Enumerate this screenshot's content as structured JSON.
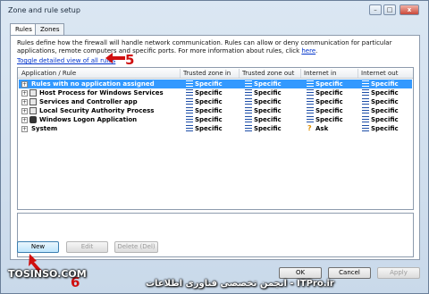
{
  "window": {
    "title": "Zone and rule setup",
    "minimize_glyph": "–",
    "maximize_glyph": "□",
    "close_glyph": "x"
  },
  "tabs": [
    {
      "label": "Rules",
      "active": true
    },
    {
      "label": "Zones",
      "active": false
    }
  ],
  "description": {
    "text": "Rules define how the firewall will handle network communication. Rules can allow or deny communication for particular applications, remote computers and specific ports. For more information about rules, click ",
    "link": "here",
    "end": "."
  },
  "toggle_link": "Toggle detailed view of all rules",
  "annotations": {
    "step5": "5",
    "step5_color": "#d01010",
    "step_new": "6"
  },
  "list": {
    "columns": [
      "Application / Rule",
      "Trusted zone in",
      "Trusted zone out",
      "Internet in",
      "Internet out"
    ],
    "rows": [
      {
        "name": "Rules with no application assigned",
        "icon": "none",
        "selected": true,
        "values": [
          "Specific",
          "Specific",
          "Specific",
          "Specific"
        ]
      },
      {
        "name": "Host Process for Windows Services",
        "icon": "app-icon",
        "selected": false,
        "values": [
          "Specific",
          "Specific",
          "Specific",
          "Specific"
        ]
      },
      {
        "name": "Services and Controller app",
        "icon": "app-icon",
        "selected": false,
        "values": [
          "Specific",
          "Specific",
          "Specific",
          "Specific"
        ]
      },
      {
        "name": "Local Security Authority Process",
        "icon": "app-icon",
        "selected": false,
        "values": [
          "Specific",
          "Specific",
          "Specific",
          "Specific"
        ]
      },
      {
        "name": "Windows Logon Application",
        "icon": "lock-icon",
        "selected": false,
        "values": [
          "Specific",
          "Specific",
          "Specific",
          "Specific"
        ]
      },
      {
        "name": "System",
        "icon": "none",
        "selected": false,
        "values": [
          "Specific",
          "Specific",
          "Ask",
          "Specific"
        ]
      }
    ]
  },
  "buttons": {
    "new": "New",
    "edit": "Edit",
    "delete": "Delete (Del)",
    "ok": "OK",
    "cancel": "Cancel",
    "apply": "Apply"
  },
  "watermark": {
    "left": "TOSINSO.COM",
    "right": "انجمن تخصصی فناوری اطلاعات - ITPro.ir"
  },
  "colors": {
    "selection": "#3399ff",
    "accent_red": "#d01010",
    "link": "#0033cc"
  }
}
